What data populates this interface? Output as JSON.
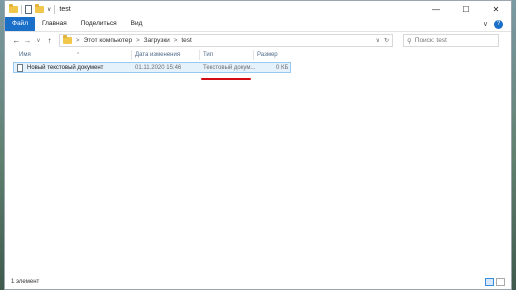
{
  "window": {
    "title": "test",
    "qa_chevron": "∨",
    "controls": {
      "minimize": "—",
      "maximize": "☐",
      "close": "✕"
    }
  },
  "ribbon": {
    "tabs": [
      "Файл",
      "Главная",
      "Поделиться",
      "Вид"
    ],
    "expand_glyph": "∨",
    "help_glyph": "?"
  },
  "nav": {
    "back": "←",
    "forward": "→",
    "recent": "∨",
    "up": "↑",
    "breadcrumb": [
      "Этот компьютер",
      "Загрузки",
      "test"
    ],
    "crumb_sep": ">",
    "dropdown": "∨",
    "refresh": "↻",
    "search_placeholder": "Поиск: test",
    "search_glyph": "⚲"
  },
  "list": {
    "columns": {
      "name": "Имя",
      "date": "Дата изменения",
      "type": "Тип",
      "size": "Размер"
    },
    "sort_caret": "^",
    "rows": [
      {
        "name": "Новый текстовый документ",
        "date": "01.11.2020 15:46",
        "type": "Текстовый докум...",
        "size": "0 КБ"
      }
    ]
  },
  "status": {
    "count": "1 элемент"
  },
  "colors": {
    "accent": "#1a6fc8",
    "selection": "#e5f1fb",
    "selection_border": "#99c9ef",
    "annotation": "#d40d12"
  }
}
